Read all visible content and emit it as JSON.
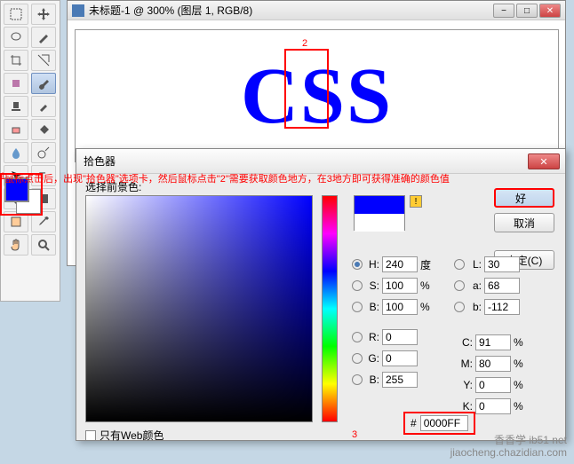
{
  "doc": {
    "title": "未标题-1 @ 300% (图层 1, RGB/8)"
  },
  "canvas": {
    "text": "CSS"
  },
  "markers": {
    "m1": "1",
    "m2": "2",
    "m3": "3"
  },
  "instruction": "鼠标点击后，出现\"拾色器\"选项卡，然后鼠标点击\"2\"需要获取颜色地方，在3地方即可获得准确的颜色值",
  "picker": {
    "title": "拾色器",
    "field_label": "选择前景色:",
    "buttons": {
      "ok": "好",
      "cancel": "取消",
      "custom": "自定(C)"
    },
    "warn": "!",
    "hsb": {
      "h_label": "H:",
      "h_val": "240",
      "h_unit": "度",
      "s_label": "S:",
      "s_val": "100",
      "s_unit": "%",
      "b_label": "B:",
      "b_val": "100",
      "b_unit": "%"
    },
    "lab": {
      "l_label": "L:",
      "l_val": "30",
      "a_label": "a:",
      "a_val": "68",
      "b_label": "b:",
      "b_val": "-112"
    },
    "rgb": {
      "r_label": "R:",
      "r_val": "0",
      "g_label": "G:",
      "g_val": "0",
      "b_label": "B:",
      "b_val": "255"
    },
    "cmyk": {
      "c_label": "C:",
      "c_val": "91",
      "unit": "%",
      "m_label": "M:",
      "m_val": "80",
      "y_label": "Y:",
      "y_val": "0",
      "k_label": "K:",
      "k_val": "0"
    },
    "hex": {
      "label": "#",
      "val": "0000FF"
    },
    "webonly": "只有Web颜色"
  },
  "watermark": {
    "l1": "香香学 ib51 net",
    "l2": "jiaocheng.chazidian.com"
  }
}
